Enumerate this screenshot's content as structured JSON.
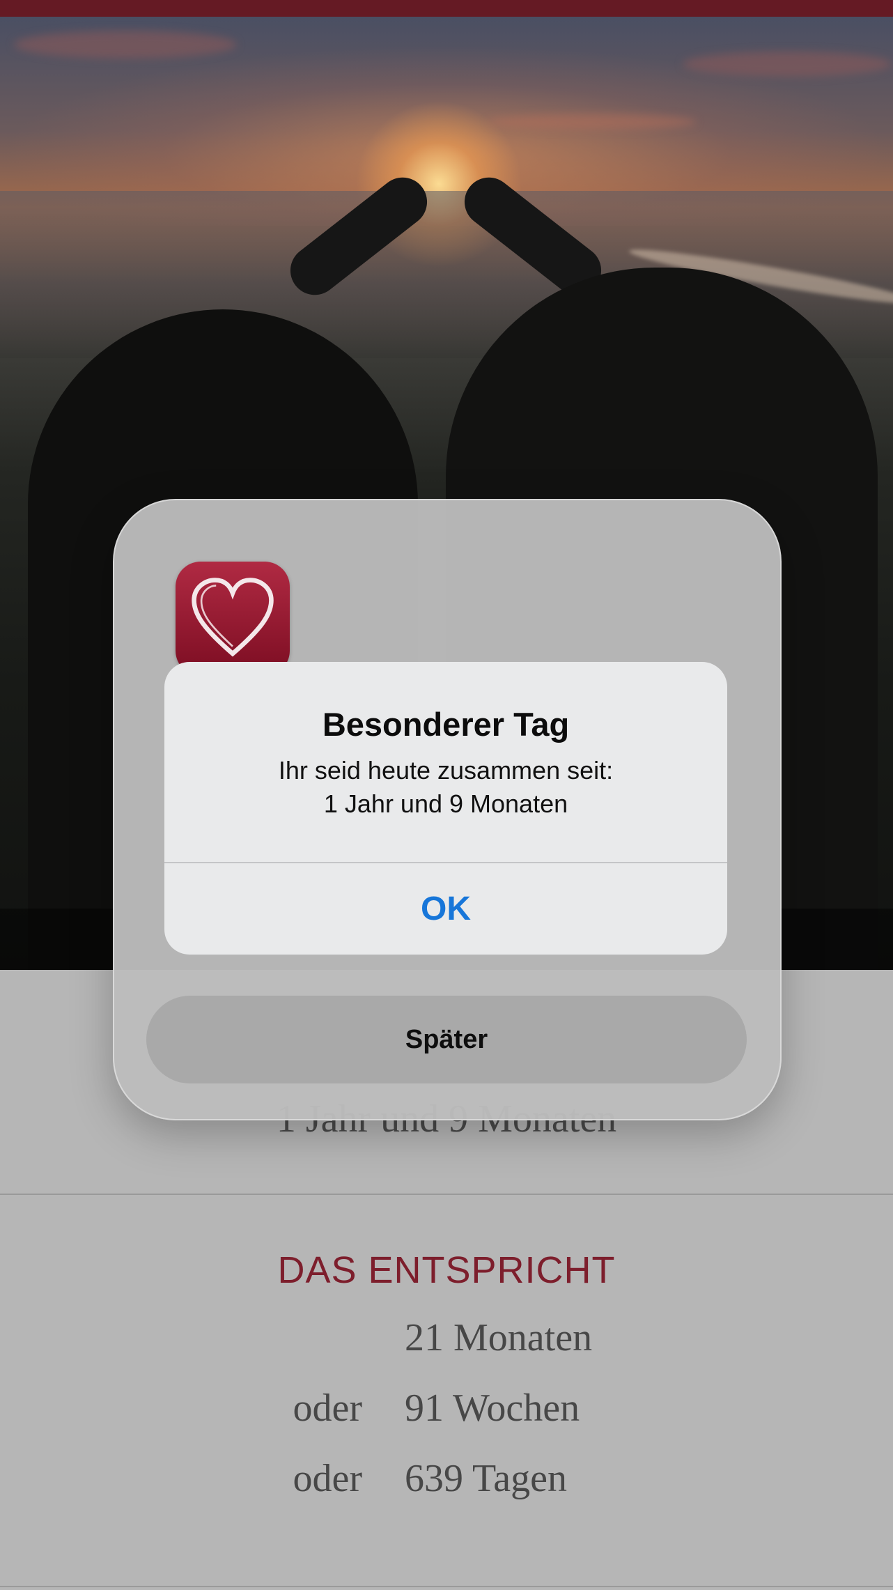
{
  "background": {
    "underlying_duration": "1 Jahr und 9 Monaten",
    "equivalent": {
      "heading": "DAS ENTSPRICHT",
      "rows": [
        {
          "prefix": "",
          "value": "21 Monaten"
        },
        {
          "prefix": "oder",
          "value": "91 Wochen"
        },
        {
          "prefix": "oder",
          "value": "639 Tagen"
        }
      ]
    }
  },
  "sheet": {
    "app_icon": "heart-icon",
    "later_label": "Später"
  },
  "alert": {
    "title": "Besonderer Tag",
    "message_line1": "Ihr seid heute zusammen seit:",
    "message_line2": "1 Jahr und 9 Monaten",
    "ok_label": "OK"
  },
  "colors": {
    "topbar": "#651a24",
    "heading_red": "#7d1e2c",
    "ok_blue": "#1776d9"
  }
}
